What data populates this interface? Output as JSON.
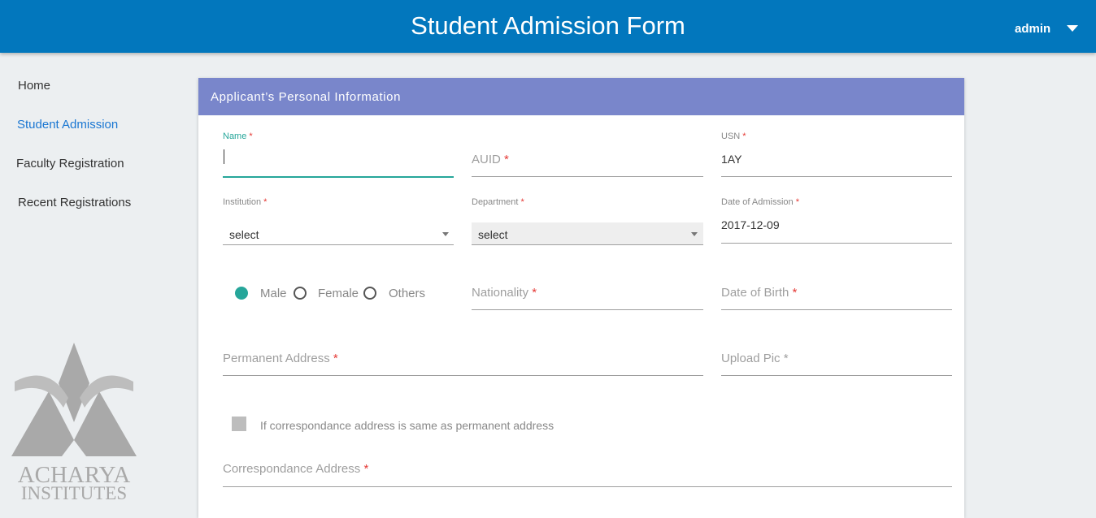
{
  "header": {
    "title": "Student Admission Form",
    "user": "admin"
  },
  "sidebar": {
    "items": [
      {
        "label": "Home"
      },
      {
        "label": "Student Admission"
      },
      {
        "label": "Faculty Registration"
      },
      {
        "label": "Recent Registrations"
      }
    ],
    "active": "Student Admission",
    "logo": {
      "line1": "ACHARYA",
      "line2": "INSTITUTES"
    }
  },
  "form": {
    "section_title": "Applicant’s Personal Information",
    "required_mark": "*",
    "name": {
      "label": "Name",
      "value": ""
    },
    "auid": {
      "placeholder": "AUID"
    },
    "usn": {
      "label": "USN",
      "value": "1AY"
    },
    "institution": {
      "label": "Institution",
      "value": "select"
    },
    "department": {
      "label": "Department",
      "value": "select"
    },
    "date_of_admission": {
      "label": "Date of Admission",
      "value": "2017-12-09"
    },
    "gender": {
      "options": [
        "Male",
        "Female",
        "Others"
      ],
      "selected": "Male"
    },
    "nationality": {
      "placeholder": "Nationality"
    },
    "date_of_birth": {
      "placeholder": "Date of Birth"
    },
    "permanent_address": {
      "placeholder": "Permanent Address"
    },
    "upload_pic": {
      "placeholder": "Upload Pic"
    },
    "same_address": {
      "label": "If correspondance address is same as permanent address",
      "checked": false
    },
    "correspondence_address": {
      "placeholder": "Correspondance Address"
    }
  },
  "colors": {
    "header": "#0277bd",
    "section_header": "#7986cb",
    "accent": "#26a69a",
    "active_nav": "#1976d2",
    "required": "#e53935"
  }
}
